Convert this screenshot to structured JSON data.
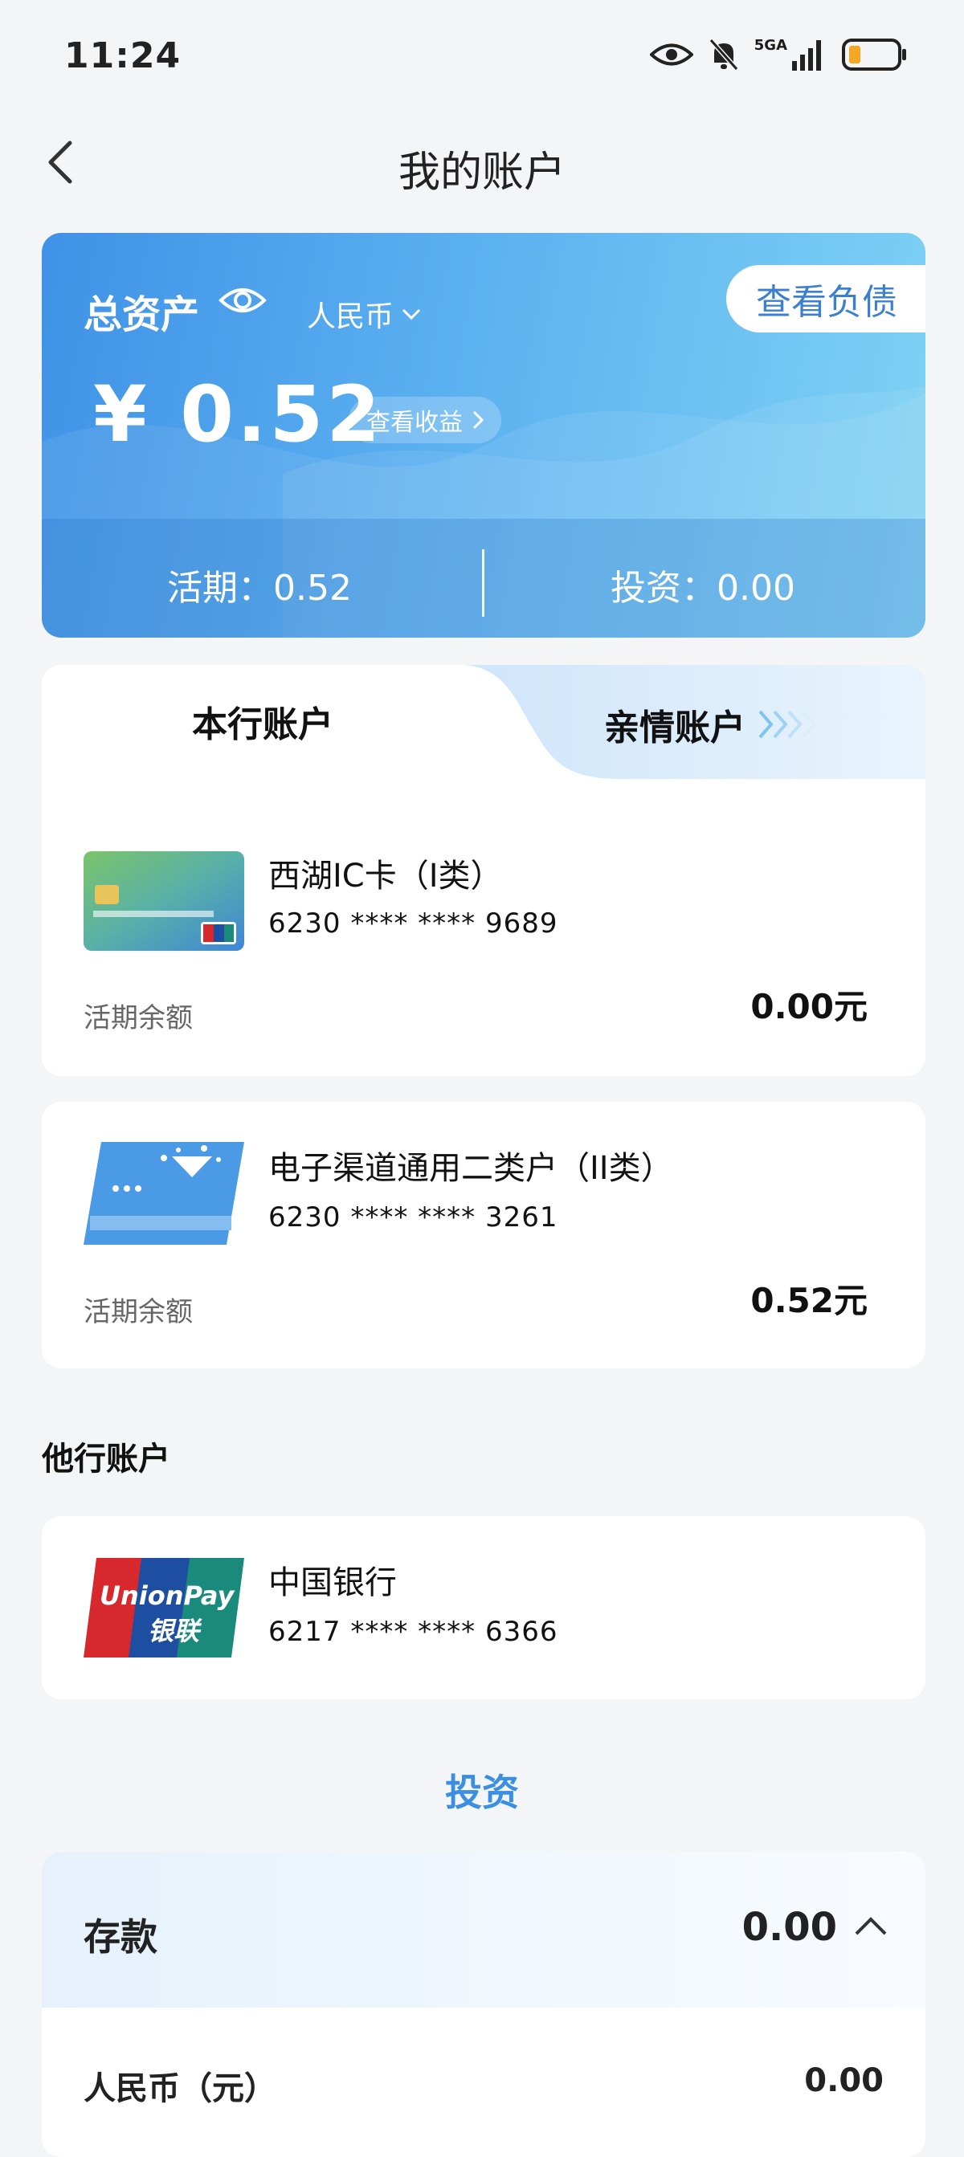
{
  "status": {
    "time": "11:24",
    "network": "5GA"
  },
  "header": {
    "title": "我的账户"
  },
  "asset": {
    "label": "总资产",
    "currency": "人民币",
    "debt_button": "查看负债",
    "amount": "¥ 0.52",
    "earnings_button": "查看收益",
    "current_label": "活期：0.52",
    "invest_label": "投资：0.00"
  },
  "tabs": {
    "own": "本行账户",
    "family": "亲情账户"
  },
  "own_accounts": [
    {
      "name": "西湖IC卡（I类）",
      "number": "6230 **** **** 9689",
      "balance_label": "活期余额",
      "balance": "0.00元"
    },
    {
      "name": "电子渠道通用二类户（II类）",
      "number": "6230 **** **** 3261",
      "balance_label": "活期余额",
      "balance": "0.52元"
    }
  ],
  "other_section": {
    "title": "他行账户"
  },
  "other_accounts": [
    {
      "name": "中国银行",
      "number": "6217 **** **** 6366",
      "logo_text_top": "UnionPay",
      "logo_text_bottom": "银联"
    }
  ],
  "invest": {
    "title": "投资"
  },
  "deposit": {
    "label": "存款",
    "total": "0.00",
    "rmb_label": "人民币（元）",
    "rmb_value": "0.00"
  },
  "colors": {
    "accent": "#3b8fe0",
    "card_start": "#3f92e6",
    "card_end": "#7fd3f5"
  }
}
